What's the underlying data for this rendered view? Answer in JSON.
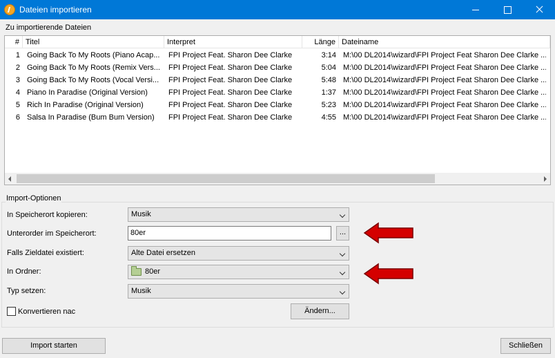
{
  "window": {
    "title": "Dateien importieren"
  },
  "files": {
    "group_label": "Zu importierende Dateien",
    "columns": [
      "#",
      "Titel",
      "Interpret",
      "Länge",
      "Dateiname"
    ],
    "rows": [
      {
        "num": "1",
        "title": "Going Back To My Roots (Piano Acap...",
        "artist": "FPI Project Feat. Sharon Dee Clarke",
        "length": "3:14",
        "file": "M:\\00 DL2014\\wizard\\FPI Project Feat Sharon Dee Clarke ..."
      },
      {
        "num": "2",
        "title": "Going Back To My Roots (Remix Vers...",
        "artist": "FPI Project Feat. Sharon Dee Clarke",
        "length": "5:04",
        "file": "M:\\00 DL2014\\wizard\\FPI Project Feat Sharon Dee Clarke ..."
      },
      {
        "num": "3",
        "title": "Going Back To My Roots (Vocal Versi...",
        "artist": "FPI Project Feat. Sharon Dee Clarke",
        "length": "5:48",
        "file": "M:\\00 DL2014\\wizard\\FPI Project Feat Sharon Dee Clarke ..."
      },
      {
        "num": "4",
        "title": "Piano In Paradise (Original Version)",
        "artist": "FPI Project Feat. Sharon Dee Clarke",
        "length": "1:37",
        "file": "M:\\00 DL2014\\wizard\\FPI Project Feat Sharon Dee Clarke ..."
      },
      {
        "num": "5",
        "title": "Rich In Paradise (Original Version)",
        "artist": "FPI Project Feat. Sharon Dee Clarke",
        "length": "5:23",
        "file": "M:\\00 DL2014\\wizard\\FPI Project Feat Sharon Dee Clarke ..."
      },
      {
        "num": "6",
        "title": "Salsa In Paradise (Bum Bum Version)",
        "artist": "FPI Project Feat. Sharon Dee Clarke",
        "length": "4:55",
        "file": "M:\\00 DL2014\\wizard\\FPI Project Feat Sharon Dee Clarke ..."
      }
    ]
  },
  "options": {
    "legend": "Import-Optionen",
    "copy_label": "In Speicherort kopieren:",
    "copy_value": "Musik",
    "subfolder_label": "Unterorder im Speicherort:",
    "subfolder_value": "80er",
    "browse_label": "...",
    "exists_label": "Falls Zieldatei existiert:",
    "exists_value": "Alte Datei ersetzen",
    "folder_label": "In Ordner:",
    "folder_value": "80er",
    "type_label": "Typ setzen:",
    "type_value": "Musik",
    "convert_label": "Konvertieren nac",
    "convert_checked": false,
    "change_label": "Ändern..."
  },
  "footer": {
    "start_label": "Import starten",
    "close_label": "Schließen"
  },
  "colors": {
    "titlebar": "#0078d7",
    "arrow": "#d40000"
  }
}
